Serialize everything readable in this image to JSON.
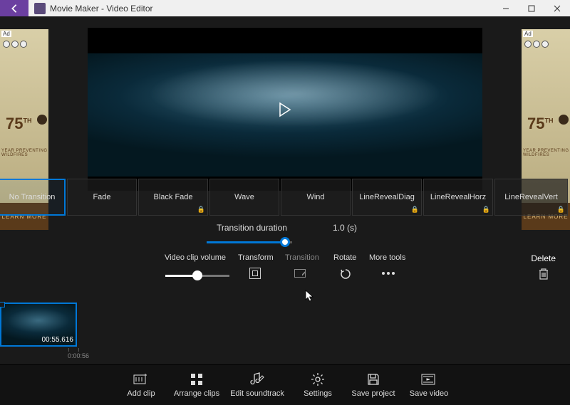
{
  "titlebar": {
    "title": "Movie Maker - Video Editor"
  },
  "ads": {
    "mark": "Ad",
    "logo_num": "75",
    "logo_suffix": "TH",
    "tagline": "YEAR PREVENTING WILDFIRES",
    "button": "LEARN MORE"
  },
  "preview": {
    "playing": false
  },
  "transitions": {
    "items": [
      {
        "label": "No Transition",
        "selected": true,
        "locked": false,
        "partial": true
      },
      {
        "label": "Fade",
        "locked": false
      },
      {
        "label": "Black Fade",
        "locked": true
      },
      {
        "label": "Wave",
        "locked": false
      },
      {
        "label": "Wind",
        "locked": false
      },
      {
        "label": "LineRevealDiag",
        "locked": true
      },
      {
        "label": "LineRevealHorz",
        "locked": true
      },
      {
        "label": "LineRevealVert",
        "locked": true,
        "partial": false
      }
    ],
    "duration_label": "Transition duration",
    "duration_value": "1.0 (s)"
  },
  "tools": {
    "volume_label": "Video clip volume",
    "transform_label": "Transform",
    "transition_label": "Transition",
    "rotate_label": "Rotate",
    "more_label": "More tools",
    "delete_label": "Delete"
  },
  "timeline": {
    "clip_time": "00:55.616",
    "ruler_label": "0:00:56"
  },
  "bottombar": {
    "add_clip": "Add clip",
    "arrange": "Arrange clips",
    "soundtrack": "Edit soundtrack",
    "settings": "Settings",
    "save_project": "Save project",
    "save_video": "Save video"
  }
}
